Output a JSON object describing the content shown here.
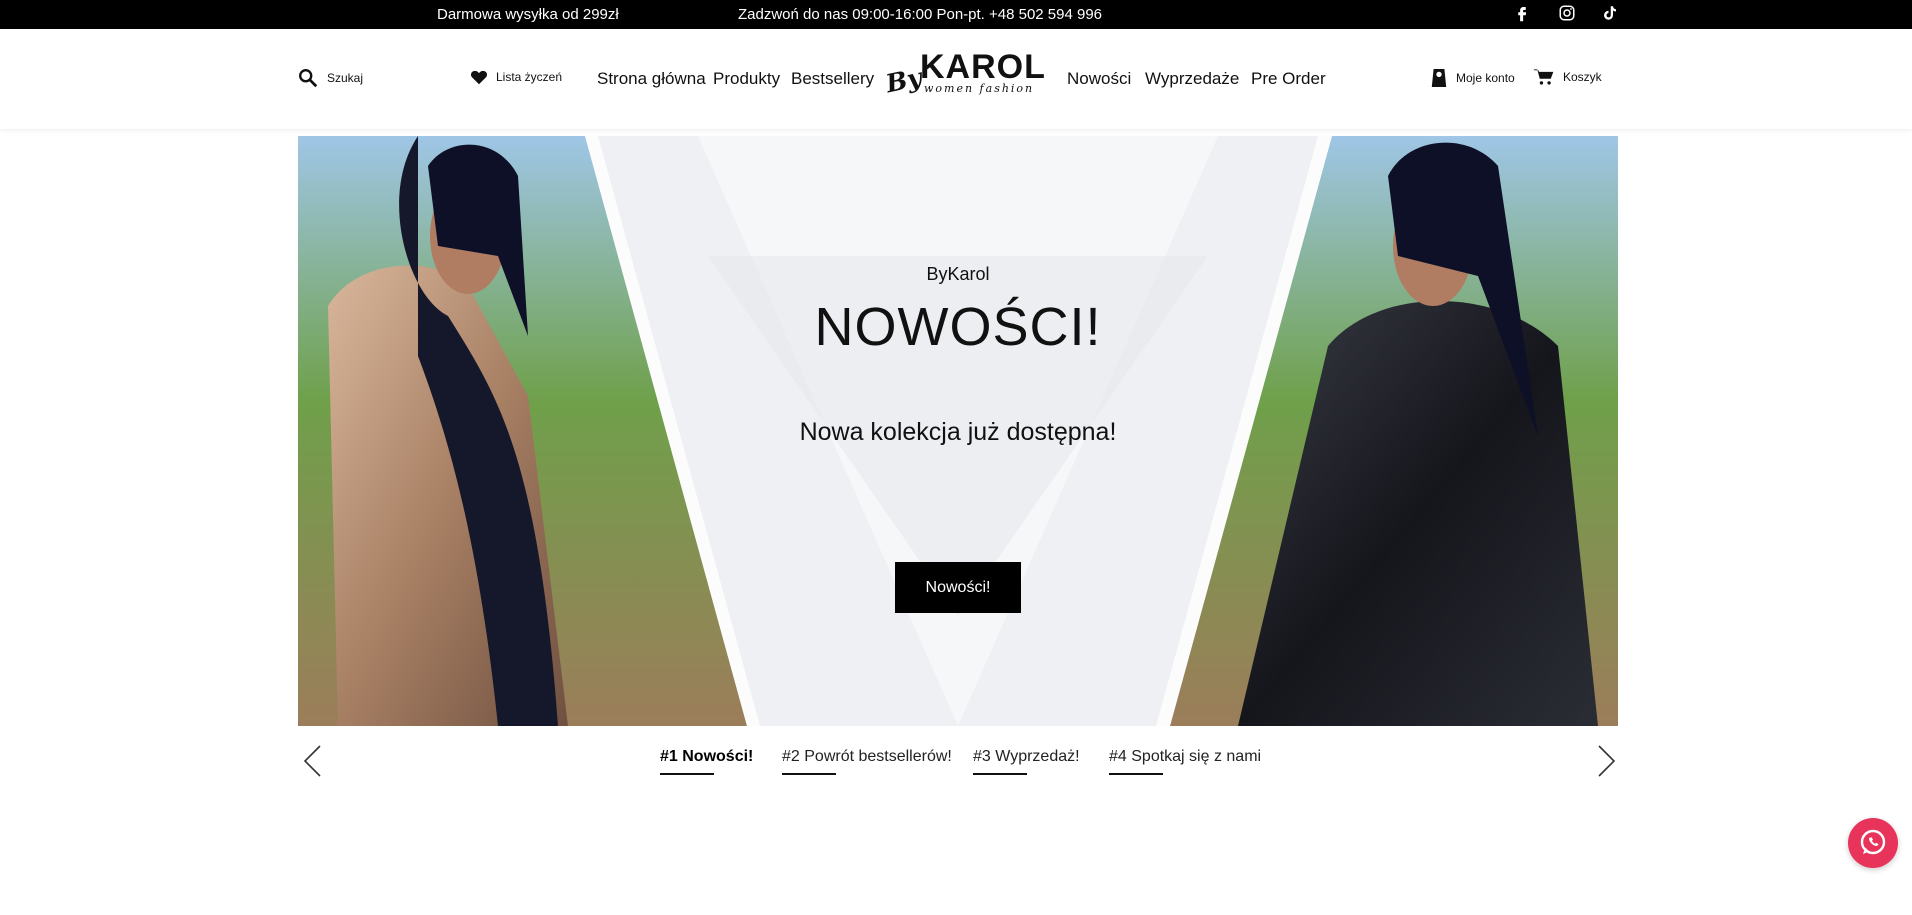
{
  "topbar": {
    "shipping": "Darmowa wysyłka od 299zł",
    "phone": "Zadzwoń do nas 09:00-16:00 Pon-pt. +48 502 594 996",
    "social": [
      "facebook-icon",
      "instagram-icon",
      "tiktok-icon"
    ]
  },
  "header": {
    "search_label": "Szukaj",
    "wishlist_label": "Lista życzeń",
    "nav": [
      "Strona główna",
      "Produkty",
      "Bestsellery",
      "Nowości",
      "Wyprzedaże",
      "Pre Order"
    ],
    "logo": {
      "by": "By",
      "karol": "KAROL",
      "tagline": "women fashion"
    },
    "account_label": "Moje konto",
    "cart_label": "Koszyk"
  },
  "hero": {
    "brand": "ByKarol",
    "title": "NOWOŚCI!",
    "subtitle": "Nowa kolekcja już dostępna!",
    "button": "Nowości!"
  },
  "slider": {
    "items": [
      "#1 Nowości!",
      "#2 Powrót bestsellerów!",
      "#3 Wyprzedaż!",
      "#4 Spotkaj się z nami"
    ],
    "active": 1
  },
  "colors": {
    "topbar": "#000000",
    "whatsapp": "#e8345a",
    "accent_text": "#111111"
  }
}
